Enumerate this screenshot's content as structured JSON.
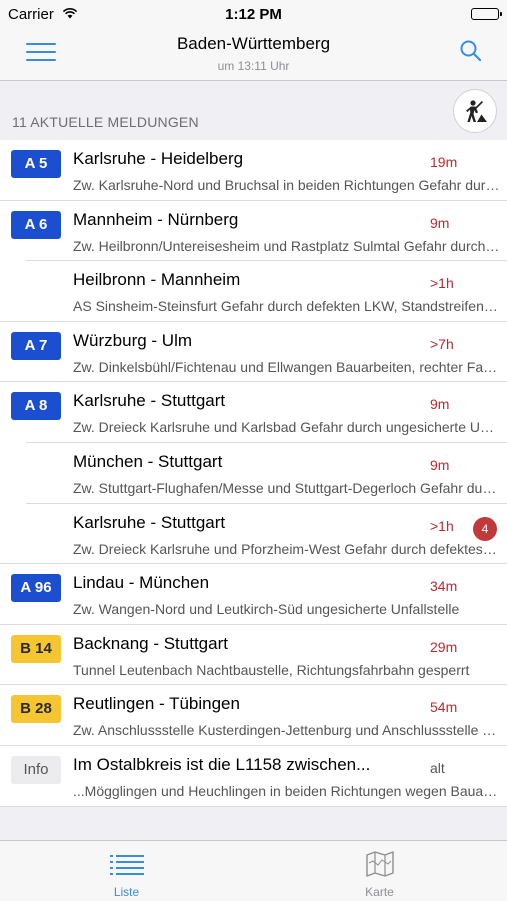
{
  "status": {
    "carrier": "Carrier",
    "time": "1:12 PM"
  },
  "nav": {
    "title": "Baden-Württemberg",
    "subtitle": "um 13:11 Uhr"
  },
  "section": {
    "count_label": "11 AKTUELLE MELDUNGEN"
  },
  "items": [
    {
      "badge": "A 5",
      "type": "a",
      "road": "Karlsruhe - Heidelberg",
      "age": "19m",
      "desc": "Zw. Karlsruhe-Nord und Bruchsal in beiden Richtungen Gefahr durch defektes Fahrzeug"
    },
    {
      "badge": "A 6",
      "type": "a",
      "road": "Mannheim - Nürnberg",
      "age": "9m",
      "desc": "Zw. Heilbronn/Untereisesheim und Rastplatz Sulmtal Gefahr durch Gegenstände"
    },
    {
      "badge": "",
      "type": "none",
      "road": "Heilbronn - Mannheim",
      "age": ">1h",
      "desc": "AS Sinsheim-Steinsfurt Gefahr durch defekten LKW, Standstreifen blockiert"
    },
    {
      "badge": "A 7",
      "type": "a",
      "road": "Würzburg - Ulm",
      "age": ">7h",
      "desc": "Zw. Dinkelsbühl/Fichtenau und Ellwangen Bauarbeiten, rechter Fahrstreifen gesperrt"
    },
    {
      "badge": "A 8",
      "type": "a",
      "road": "Karlsruhe - Stuttgart",
      "age": "9m",
      "desc": "Zw. Dreieck Karlsruhe und Karlsbad Gefahr durch ungesicherte Unfallstelle"
    },
    {
      "badge": "",
      "type": "none",
      "road": "München - Stuttgart",
      "age": "9m",
      "desc": "Zw. Stuttgart-Flughafen/Messe und Stuttgart-Degerloch Gefahr durch Gegenstände"
    },
    {
      "badge": "",
      "type": "none",
      "road": "Karlsruhe - Stuttgart",
      "age": ">1h",
      "count": "4",
      "desc": "Zw. Dreieck Karlsruhe und Pforzheim-West Gefahr durch defektes Fahrzeug"
    },
    {
      "badge": "A 96",
      "type": "a",
      "road": "Lindau - München",
      "age": "34m",
      "desc": "Zw. Wangen-Nord und Leutkirch-Süd ungesicherte Unfallstelle"
    },
    {
      "badge": "B 14",
      "type": "b",
      "road": "Backnang - Stuttgart",
      "age": "29m",
      "desc": "Tunnel Leutenbach Nachtbaustelle, Richtungsfahrbahn gesperrt"
    },
    {
      "badge": "B 28",
      "type": "b",
      "road": "Reutlingen - Tübingen",
      "age": "54m",
      "desc": "Zw. Anschlussstelle Kusterdingen-Jettenburg und Anschlussstelle Tübingen"
    },
    {
      "badge": "Info",
      "type": "info",
      "road": "Im Ostalbkreis ist die L1158 zwischen...",
      "age": "alt",
      "age_style": "old",
      "desc": "...Mögglingen und Heuchlingen in beiden Richtungen wegen Bauarbeiten gesperrt"
    }
  ],
  "tabs": [
    {
      "label": "Liste",
      "active": true
    },
    {
      "label": "Karte",
      "active": false
    }
  ],
  "colors": {
    "accent": "#3a8dde",
    "autobahn": "#1c4fd0",
    "bundesstrasse": "#f6c632",
    "age_red": "#c0282f",
    "count_badge": "#c0393b"
  },
  "icons": {
    "menu": "hamburger-menu-icon",
    "search": "search-icon",
    "roadwork": "roadwork-icon",
    "list": "list-icon",
    "map": "map-icon",
    "wifi": "wifi-icon",
    "battery": "battery-icon"
  }
}
